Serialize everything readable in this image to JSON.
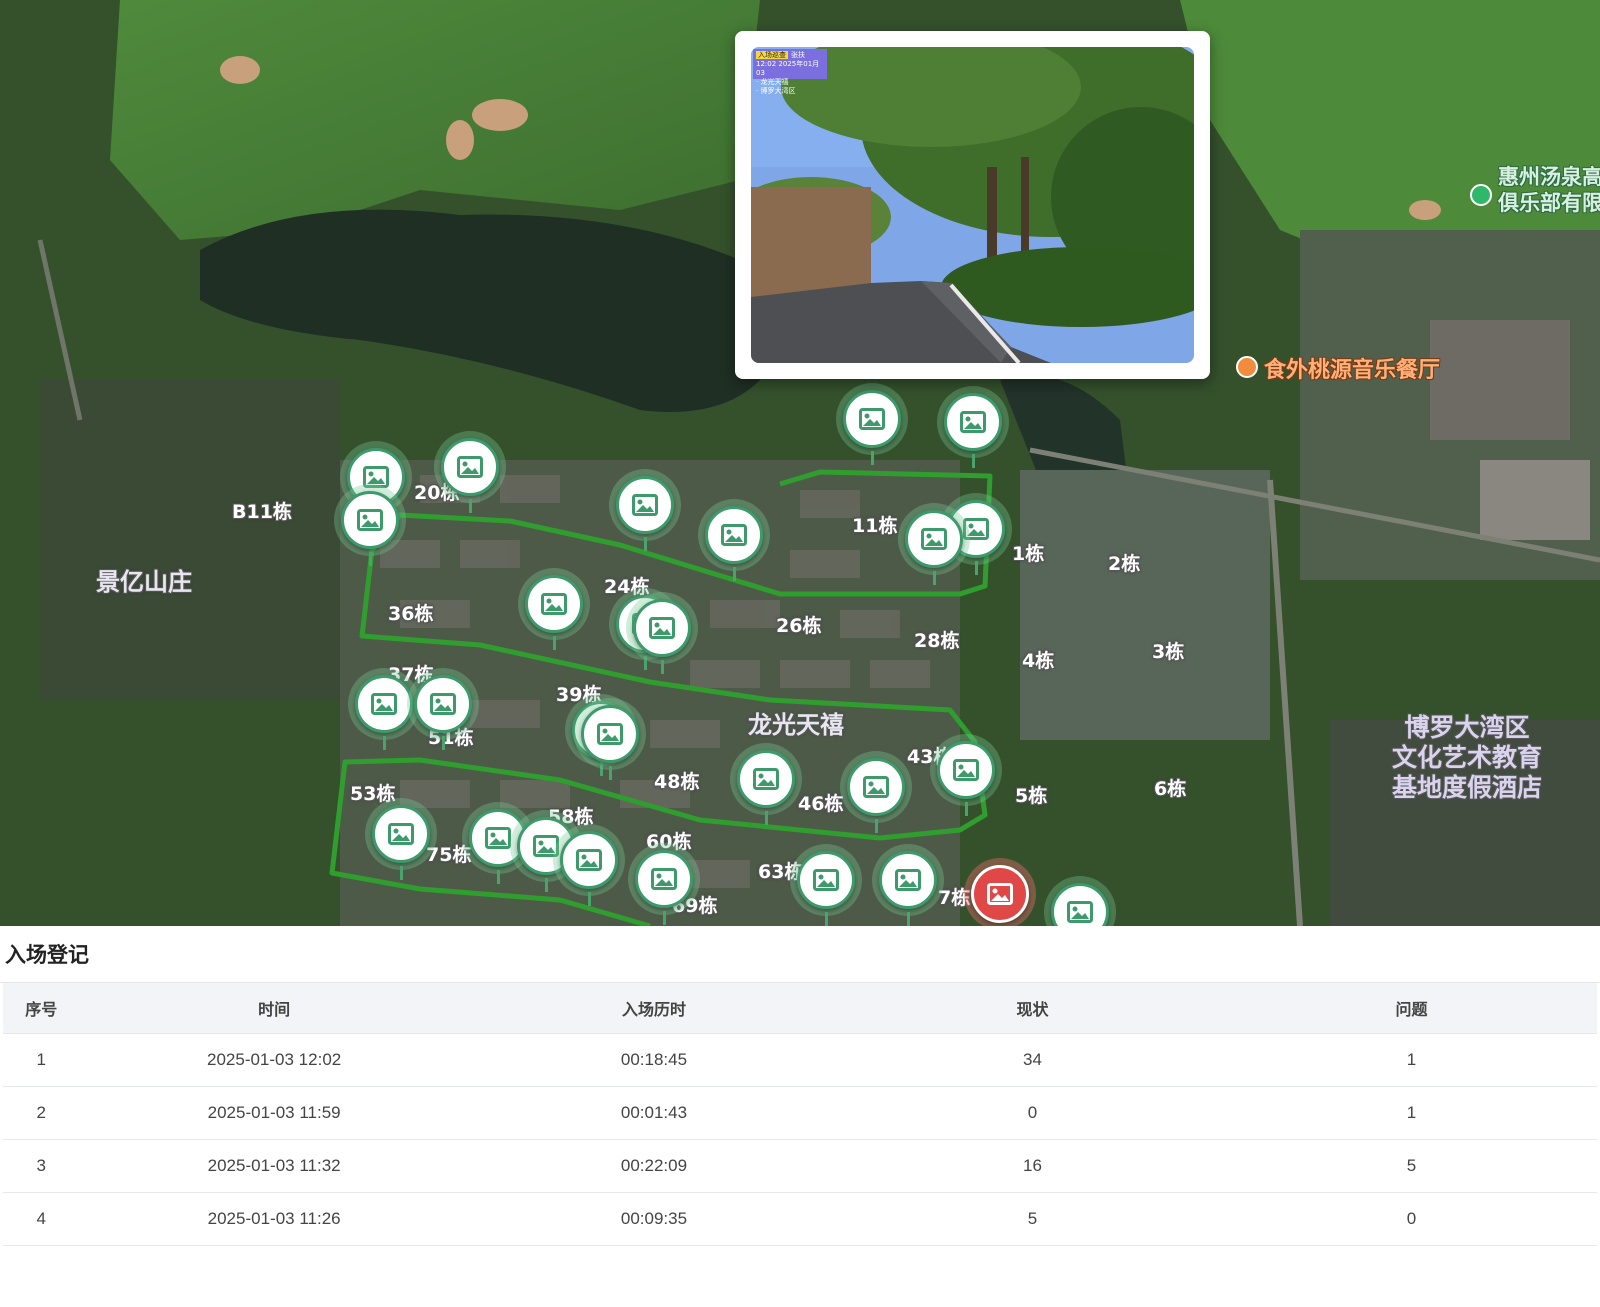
{
  "map": {
    "area_labels": [
      "景亿山庄",
      "龙光天禧"
    ],
    "poi_labels": {
      "club": "惠州汤泉高\n俱乐部有限",
      "restaurant": "食外桃源音乐餐厅",
      "hotel": "博罗大湾区\n文化艺术教育\n基地度假酒店"
    },
    "building_labels": [
      "B11栋",
      "20栋",
      "11栋",
      "1栋",
      "2栋",
      "36栋",
      "24栋",
      "26栋",
      "28栋",
      "4栋",
      "3栋",
      "37栋",
      "39栋",
      "51栋",
      "43栋",
      "5栋",
      "6栋",
      "48栋",
      "46栋",
      "53栋",
      "58栋",
      "75栋",
      "60栋",
      "63栋",
      "7栋",
      "69栋"
    ],
    "photo_stamp": {
      "tag": "入场巡查",
      "title": "张扶",
      "time": "12:02",
      "line2": "2025年01月03",
      "line3": "· 龙光天禧",
      "line4": "· 博罗大湾区"
    },
    "marker_color": "#3d9a6a",
    "alert_marker_color": "#e04848",
    "route_color": "#2f9e2f"
  },
  "register": {
    "title": "入场登记",
    "columns": [
      "序号",
      "时间",
      "入场历时",
      "现状",
      "问题"
    ],
    "rows": [
      [
        "1",
        "2025-01-03 12:02",
        "00:18:45",
        "34",
        "1"
      ],
      [
        "2",
        "2025-01-03 11:59",
        "00:01:43",
        "0",
        "1"
      ],
      [
        "3",
        "2025-01-03 11:32",
        "00:22:09",
        "16",
        "5"
      ],
      [
        "4",
        "2025-01-03 11:26",
        "00:09:35",
        "5",
        "0"
      ]
    ]
  }
}
